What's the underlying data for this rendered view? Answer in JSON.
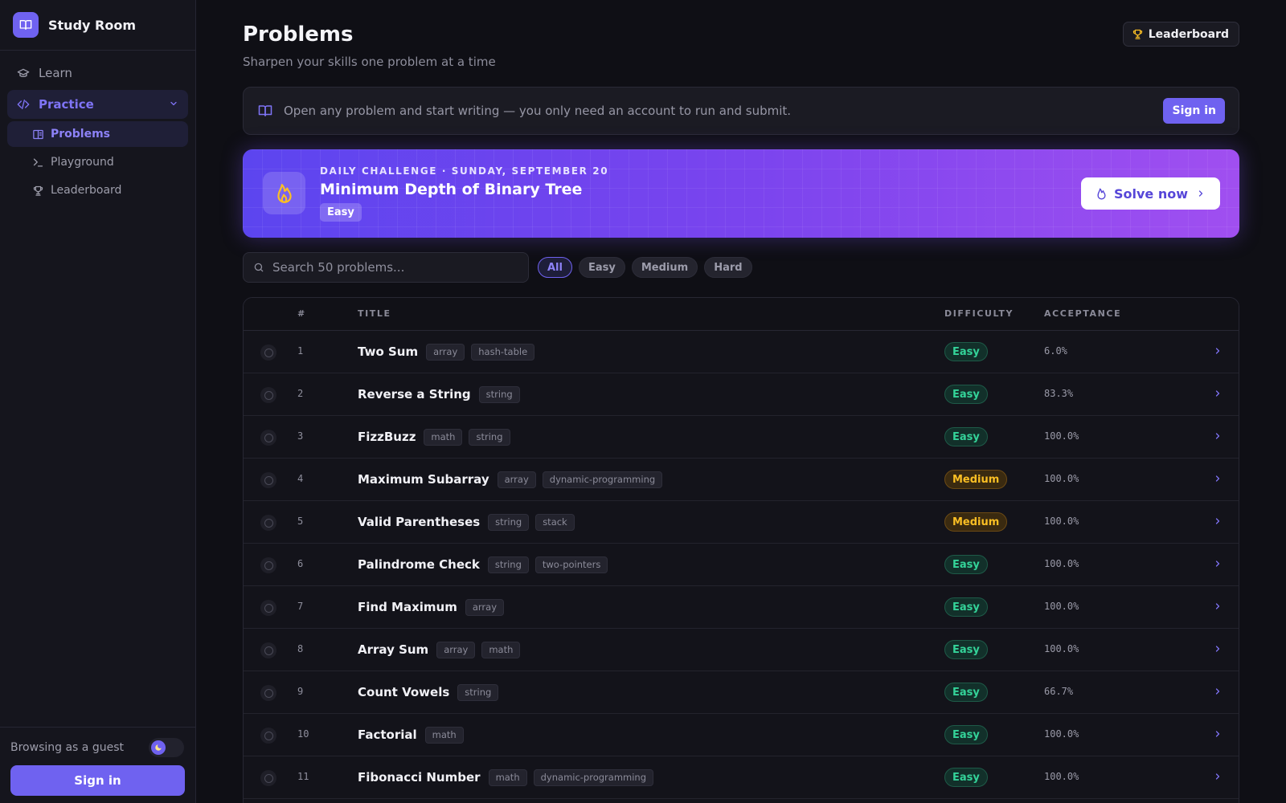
{
  "brand": {
    "name": "Study Room"
  },
  "nav": {
    "learn": "Learn",
    "practice": "Practice",
    "sub": {
      "problems": "Problems",
      "playground": "Playground",
      "leaderboard": "Leaderboard"
    }
  },
  "footer": {
    "guest_text": "Browsing as a guest",
    "signin": "Sign in"
  },
  "header": {
    "title": "Problems",
    "subtitle": "Sharpen your skills one problem at a time",
    "leaderboard_btn": "Leaderboard"
  },
  "notice": {
    "text": "Open any problem and start writing — you only need an account to run and submit.",
    "signin": "Sign in"
  },
  "daily": {
    "eyebrow": "DAILY CHALLENGE · SUNDAY, SEPTEMBER 20",
    "title": "Minimum Depth of Binary Tree",
    "difficulty": "Easy",
    "cta": "Solve now"
  },
  "search": {
    "placeholder": "Search 50 problems..."
  },
  "filters": [
    "All",
    "Easy",
    "Medium",
    "Hard"
  ],
  "table": {
    "headers": {
      "num": "#",
      "title": "TITLE",
      "difficulty": "DIFFICULTY",
      "acceptance": "ACCEPTANCE"
    },
    "rows": [
      {
        "num": "1",
        "title": "Two Sum",
        "tags": [
          "array",
          "hash-table"
        ],
        "difficulty": "Easy",
        "acceptance": "6.0%"
      },
      {
        "num": "2",
        "title": "Reverse a String",
        "tags": [
          "string"
        ],
        "difficulty": "Easy",
        "acceptance": "83.3%"
      },
      {
        "num": "3",
        "title": "FizzBuzz",
        "tags": [
          "math",
          "string"
        ],
        "difficulty": "Easy",
        "acceptance": "100.0%"
      },
      {
        "num": "4",
        "title": "Maximum Subarray",
        "tags": [
          "array",
          "dynamic-programming"
        ],
        "difficulty": "Medium",
        "acceptance": "100.0%"
      },
      {
        "num": "5",
        "title": "Valid Parentheses",
        "tags": [
          "string",
          "stack"
        ],
        "difficulty": "Medium",
        "acceptance": "100.0%"
      },
      {
        "num": "6",
        "title": "Palindrome Check",
        "tags": [
          "string",
          "two-pointers"
        ],
        "difficulty": "Easy",
        "acceptance": "100.0%"
      },
      {
        "num": "7",
        "title": "Find Maximum",
        "tags": [
          "array"
        ],
        "difficulty": "Easy",
        "acceptance": "100.0%"
      },
      {
        "num": "8",
        "title": "Array Sum",
        "tags": [
          "array",
          "math"
        ],
        "difficulty": "Easy",
        "acceptance": "100.0%"
      },
      {
        "num": "9",
        "title": "Count Vowels",
        "tags": [
          "string"
        ],
        "difficulty": "Easy",
        "acceptance": "66.7%"
      },
      {
        "num": "10",
        "title": "Factorial",
        "tags": [
          "math"
        ],
        "difficulty": "Easy",
        "acceptance": "100.0%"
      },
      {
        "num": "11",
        "title": "Fibonacci Number",
        "tags": [
          "math",
          "dynamic-programming"
        ],
        "difficulty": "Easy",
        "acceptance": "100.0%"
      }
    ]
  },
  "colors": {
    "accent": "#6f62f0",
    "easy": "#34d399",
    "medium": "#fbbf24"
  }
}
